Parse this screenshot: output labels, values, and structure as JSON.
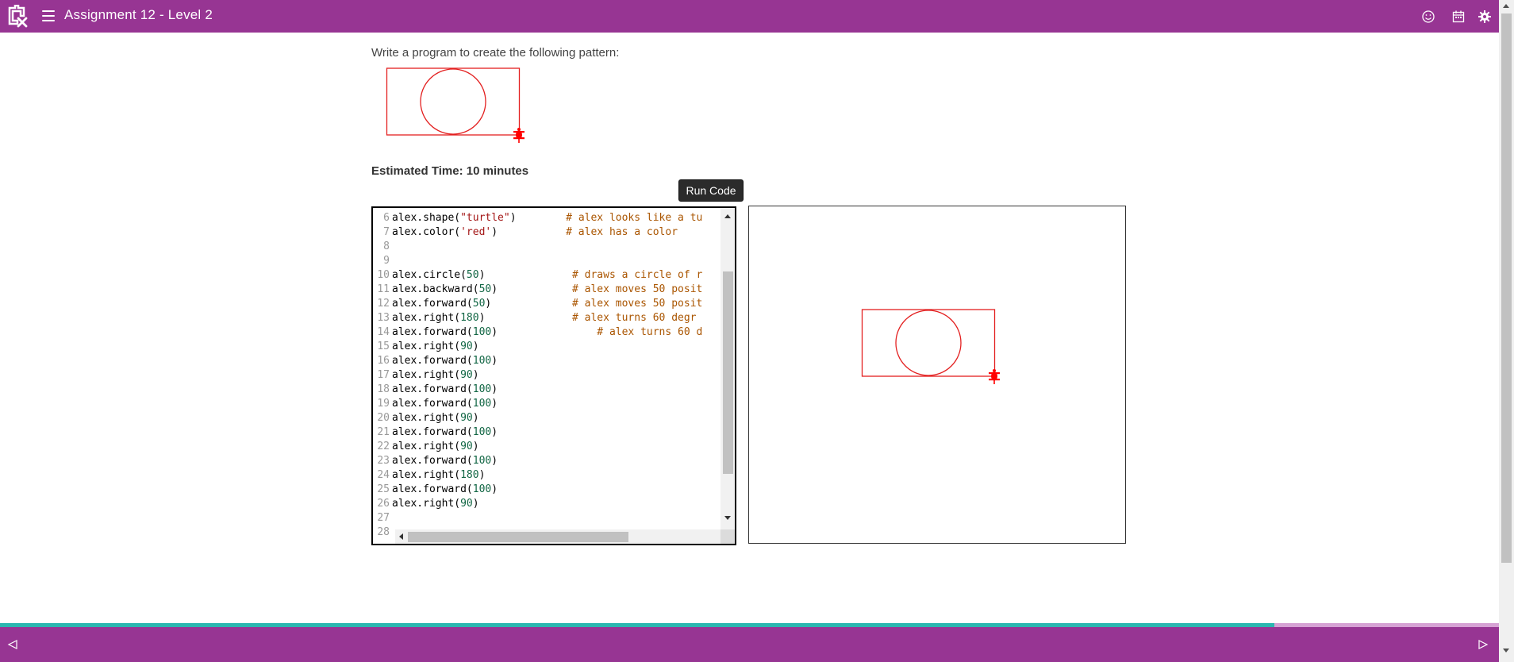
{
  "header": {
    "title": "Assignment 12 - Level 2",
    "icons": [
      "logo-icon",
      "hamburger-menu-icon",
      "smiley-icon",
      "calendar-icon",
      "settings-gear-icon"
    ],
    "background": "#973593"
  },
  "content": {
    "prompt": "Write a program to create the following pattern:",
    "estimated_time": "Estimated Time: 10 minutes",
    "run_button": "Run Code"
  },
  "editor": {
    "lines": [
      {
        "n": "6",
        "code": "alex.shape(",
        "str": "\"turtle\"",
        "rest": ")",
        "comment": "        # alex looks like a tu"
      },
      {
        "n": "7",
        "code": "alex.color(",
        "str": "'red'",
        "rest": ")",
        "comment": "           # alex has a color"
      },
      {
        "n": "8",
        "code": "",
        "str": "",
        "rest": "",
        "comment": ""
      },
      {
        "n": "9",
        "code": "",
        "str": "",
        "rest": "",
        "comment": ""
      },
      {
        "n": "10",
        "code": "alex.circle(",
        "num": "50",
        "rest": ")",
        "comment": "              # draws a circle of r"
      },
      {
        "n": "11",
        "code": "alex.backward(",
        "num": "50",
        "rest": ")",
        "comment": "            # alex moves 50 posit"
      },
      {
        "n": "12",
        "code": "alex.forward(",
        "num": "50",
        "rest": ")",
        "comment": "             # alex moves 50 posit"
      },
      {
        "n": "13",
        "code": "alex.right(",
        "num": "180",
        "rest": ")",
        "comment": "              # alex turns 60 degr"
      },
      {
        "n": "14",
        "code": "alex.forward(",
        "num": "100",
        "rest": ")",
        "comment": "                # alex turns 60 d"
      },
      {
        "n": "15",
        "code": "alex.right(",
        "num": "90",
        "rest": ")",
        "comment": ""
      },
      {
        "n": "16",
        "code": "alex.forward(",
        "num": "100",
        "rest": ")",
        "comment": ""
      },
      {
        "n": "17",
        "code": "alex.right(",
        "num": "90",
        "rest": ")",
        "comment": ""
      },
      {
        "n": "18",
        "code": "alex.forward(",
        "num": "100",
        "rest": ")",
        "comment": ""
      },
      {
        "n": "19",
        "code": "alex.forward(",
        "num": "100",
        "rest": ")",
        "comment": ""
      },
      {
        "n": "20",
        "code": "alex.right(",
        "num": "90",
        "rest": ")",
        "comment": ""
      },
      {
        "n": "21",
        "code": "alex.forward(",
        "num": "100",
        "rest": ")",
        "comment": ""
      },
      {
        "n": "22",
        "code": "alex.right(",
        "num": "90",
        "rest": ")",
        "comment": ""
      },
      {
        "n": "23",
        "code": "alex.forward(",
        "num": "100",
        "rest": ")",
        "comment": ""
      },
      {
        "n": "24",
        "code": "alex.right(",
        "num": "180",
        "rest": ")",
        "comment": ""
      },
      {
        "n": "25",
        "code": "alex.forward(",
        "num": "100",
        "rest": ")",
        "comment": ""
      },
      {
        "n": "26",
        "code": "alex.right(",
        "num": "90",
        "rest": ")",
        "comment": ""
      },
      {
        "n": "27",
        "code": "",
        "str": "",
        "rest": "",
        "comment": ""
      },
      {
        "n": "28",
        "code": "",
        "str": "",
        "rest": "",
        "comment": ""
      }
    ]
  },
  "footer": {
    "progress": 0.85,
    "icons": [
      "previous-arrow-icon",
      "next-arrow-icon"
    ]
  },
  "colors": {
    "accent": "#973593",
    "progress_fill": "#2ab7b0",
    "progress_track": "#d6a2d4",
    "turtle": "#ff0000"
  }
}
